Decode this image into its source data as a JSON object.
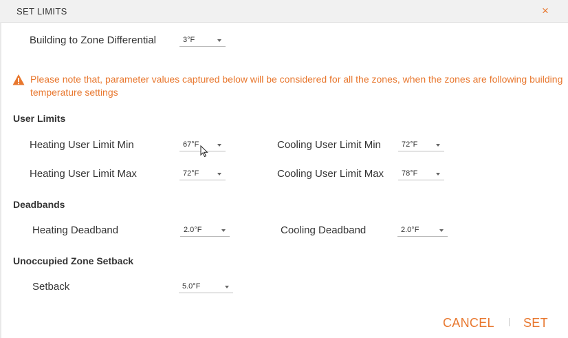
{
  "dialog": {
    "title": "SET LIMITS",
    "close_glyph": "×"
  },
  "building": {
    "label": "Building to Zone Differential",
    "value": "3°F"
  },
  "warning": {
    "icon": "warning-triangle-icon",
    "text": "Please note that, parameter values captured below will be considered for all the zones, when the zones are following building temperature settings"
  },
  "user_limits": {
    "heading": "User Limits",
    "heating_min": {
      "label": "Heating User Limit Min",
      "value": "67°F"
    },
    "cooling_min": {
      "label": "Cooling User Limit Min",
      "value": "72°F"
    },
    "heating_max": {
      "label": "Heating User Limit Max",
      "value": "72°F"
    },
    "cooling_max": {
      "label": "Cooling User Limit Max",
      "value": "78°F"
    }
  },
  "deadbands": {
    "heading": "Deadbands",
    "heating": {
      "label": "Heating Deadband",
      "value": "2.0°F"
    },
    "cooling": {
      "label": "Cooling Deadband",
      "value": "2.0°F"
    }
  },
  "setback": {
    "heading": "Unoccupied Zone Setback",
    "label": "Setback",
    "value": "5.0°F"
  },
  "footer": {
    "cancel_label": "CANCEL",
    "set_label": "SET"
  },
  "colors": {
    "accent": "#e8772e",
    "titlebar": "#f1f1f1",
    "text": "#333333"
  }
}
